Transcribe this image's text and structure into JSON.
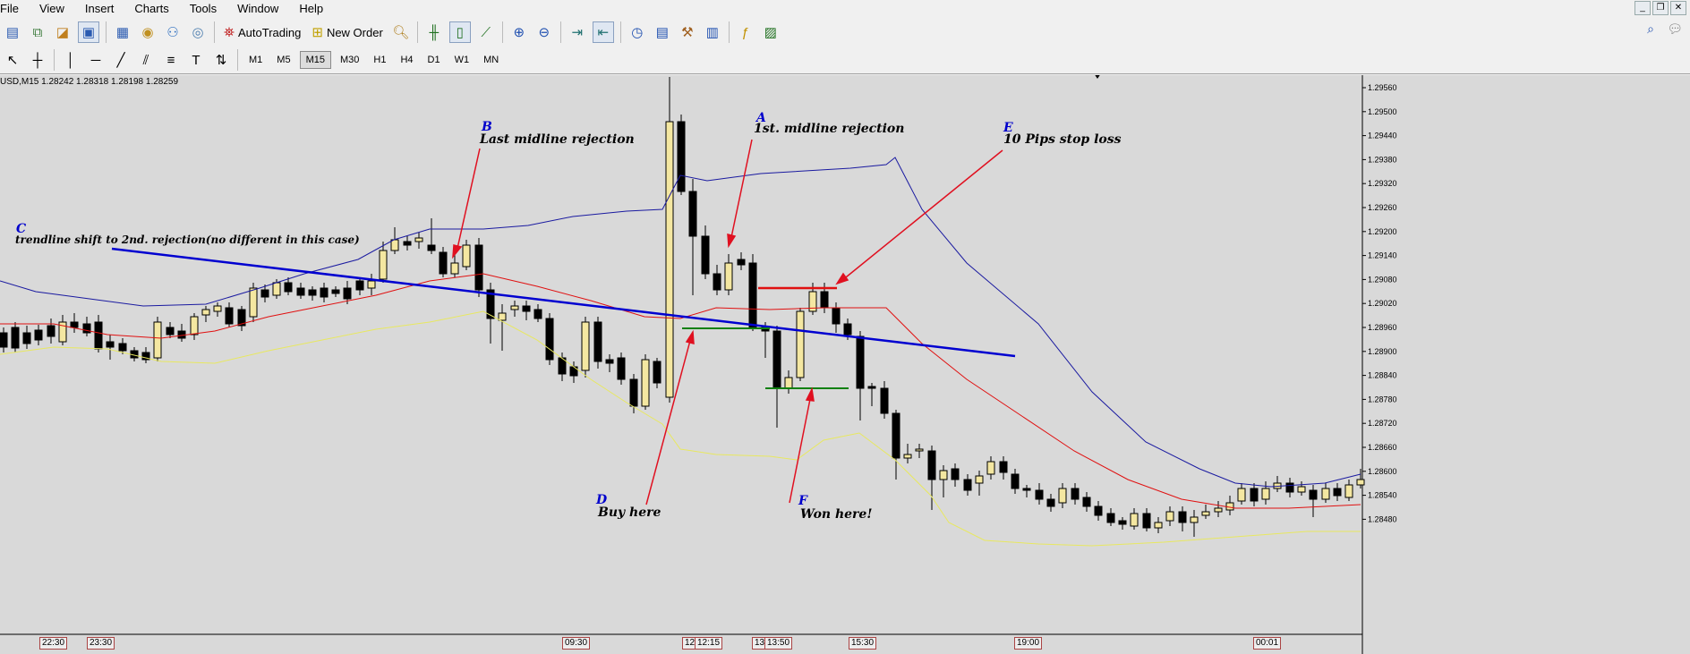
{
  "menu": [
    "File",
    "View",
    "Insert",
    "Charts",
    "Tools",
    "Window",
    "Help"
  ],
  "toolbar": {
    "autotrading_label": "AutoTrading",
    "neworder_label": "New Order"
  },
  "timeframes": [
    "M1",
    "M5",
    "M15",
    "M30",
    "H1",
    "H4",
    "D1",
    "W1",
    "MN"
  ],
  "active_timeframe": "M15",
  "symbol_info": "USD,M15  1.28242 1.28318 1.28198 1.28259",
  "price_ticks": [
    "1.29560",
    "1.29500",
    "1.29440",
    "1.29380",
    "1.29320",
    "1.29260",
    "1.29200",
    "1.29140",
    "1.29080",
    "1.29020",
    "1.28960",
    "1.28900",
    "1.28840",
    "1.28780",
    "1.28720",
    "1.28660",
    "1.28600",
    "1.28540",
    "1.28480"
  ],
  "time_ticks": [
    "22:30",
    "23:30",
    "09:30",
    "12:",
    "12:15",
    "13:",
    "13:50",
    "15:30",
    "19:00",
    "00:01"
  ],
  "annotations": {
    "a_letter": "A",
    "a_text": "1st. midline rejection",
    "b_letter": "B",
    "b_text": "Last midline rejection",
    "c_letter": "C",
    "c_text": "trendline shift to 2nd. rejection(no different in this case)",
    "d_letter": "D",
    "d_text": "Buy here",
    "e_letter": "E",
    "e_text": "10 Pips stop loss",
    "f_letter": "F",
    "f_text": "Won here!"
  },
  "colors": {
    "chart_bg": "#d9d9d9",
    "bull_candle": "#f4e7a1",
    "bear_candle": "#000000",
    "upper_band": "#1a1aa0",
    "mid_band": "#e01010",
    "lower_band": "#f0f060",
    "trendline": "#0000d0",
    "stop_line": "#e01010",
    "entry_line": "#108010",
    "arrow": "#e01020"
  }
}
